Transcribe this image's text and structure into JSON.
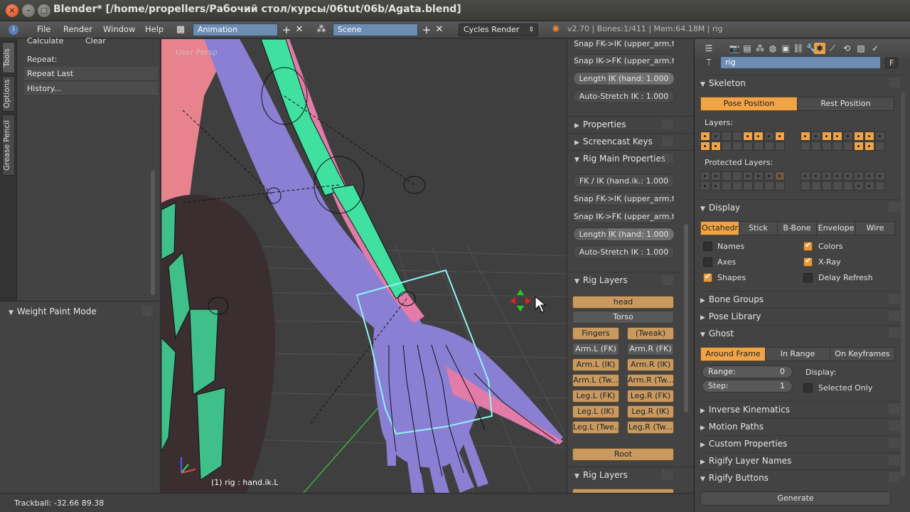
{
  "window": {
    "title": "Blender* [/home/propellers/Рабочий стол/курсы/06tut/06b/Agata.blend]"
  },
  "menu": {
    "items": [
      "File",
      "Render",
      "Window",
      "Help"
    ],
    "screen_layout": "Animation",
    "scene": "Scene",
    "render_engine": "Cycles Render",
    "stats": "v2.70 | Bones:1/411 | Mem:64.18M | rig"
  },
  "tool_shelf": {
    "tabs": [
      "Tools",
      "Options",
      "Grease Pencil"
    ],
    "calc_label": "Calculate",
    "clear_label": "Clear",
    "repeat_label": "Repeat:",
    "repeat_last": "Repeat Last",
    "history": "History...",
    "mode_panel": "Weight Paint Mode"
  },
  "viewport": {
    "view_label": "User Persp",
    "object_label": "(1) rig : hand.ik.L"
  },
  "status": {
    "trackball": "Trackball: -32.66 89.38"
  },
  "npanel": {
    "top_buttons": [
      "Snap FK->IK (upper_arm.f...",
      "Snap IK->FK (upper_arm.f...",
      "Length IK (hand: 1.000",
      "Auto-Stretch IK : 1.000"
    ],
    "properties": "Properties",
    "screencast": "Screencast Keys",
    "rig_main": "Rig Main Properties",
    "main_buttons": [
      "FK / IK (hand.ik.: 1.000",
      "Snap FK->IK (upper_arm.f...",
      "Snap IK->FK (upper_arm.f...",
      "Length IK (hand: 1.000",
      "Auto-Stretch IK : 1.000"
    ],
    "rig_layers": "Rig Layers",
    "head": "head",
    "torso": "Torso",
    "pairs": [
      [
        "Fingers",
        "(Tweak)"
      ],
      [
        "Arm.L (FK)",
        "Arm.R (FK)"
      ],
      [
        "Arm.L (IK)",
        "Arm.R (IK)"
      ],
      [
        "Arm.L (Tw...",
        "Arm.R (Tw..."
      ],
      [
        "Leg.L (FK)",
        "Leg.R (FK)"
      ],
      [
        "Leg.L (IK)",
        "Leg.R (IK)"
      ],
      [
        "Leg.L (Twe...",
        "Leg.R (Tw..."
      ]
    ],
    "root": "Root",
    "rig_layers2": "Rig Layers"
  },
  "props": {
    "name": "rig",
    "name_suffix": "F",
    "skeleton": "Skeleton",
    "pose_position": "Pose Position",
    "rest_position": "Rest Position",
    "layers": "Layers:",
    "protected_layers": "Protected Layers:",
    "display": "Display",
    "display_modes": [
      "Octahedr",
      "Stick",
      "B-Bone",
      "Envelope",
      "Wire"
    ],
    "names": "Names",
    "axes": "Axes",
    "shapes": "Shapes",
    "colors": "Colors",
    "xray": "X-Ray",
    "delay_refresh": "Delay Refresh",
    "bone_groups": "Bone Groups",
    "pose_library": "Pose Library",
    "ghost": "Ghost",
    "ghost_modes": [
      "Around Frame",
      "In Range",
      "On Keyframes"
    ],
    "range_label": "Range:",
    "range_value": "0",
    "step_label": "Step:",
    "step_value": "1",
    "display_label": "Display:",
    "selected_only": "Selected Only",
    "inverse_kinematics": "Inverse Kinematics",
    "motion_paths": "Motion Paths",
    "custom_properties": "Custom Properties",
    "rigify_layer_names": "Rigify Layer Names",
    "rigify_buttons": "Rigify Buttons",
    "generate": "Generate"
  }
}
